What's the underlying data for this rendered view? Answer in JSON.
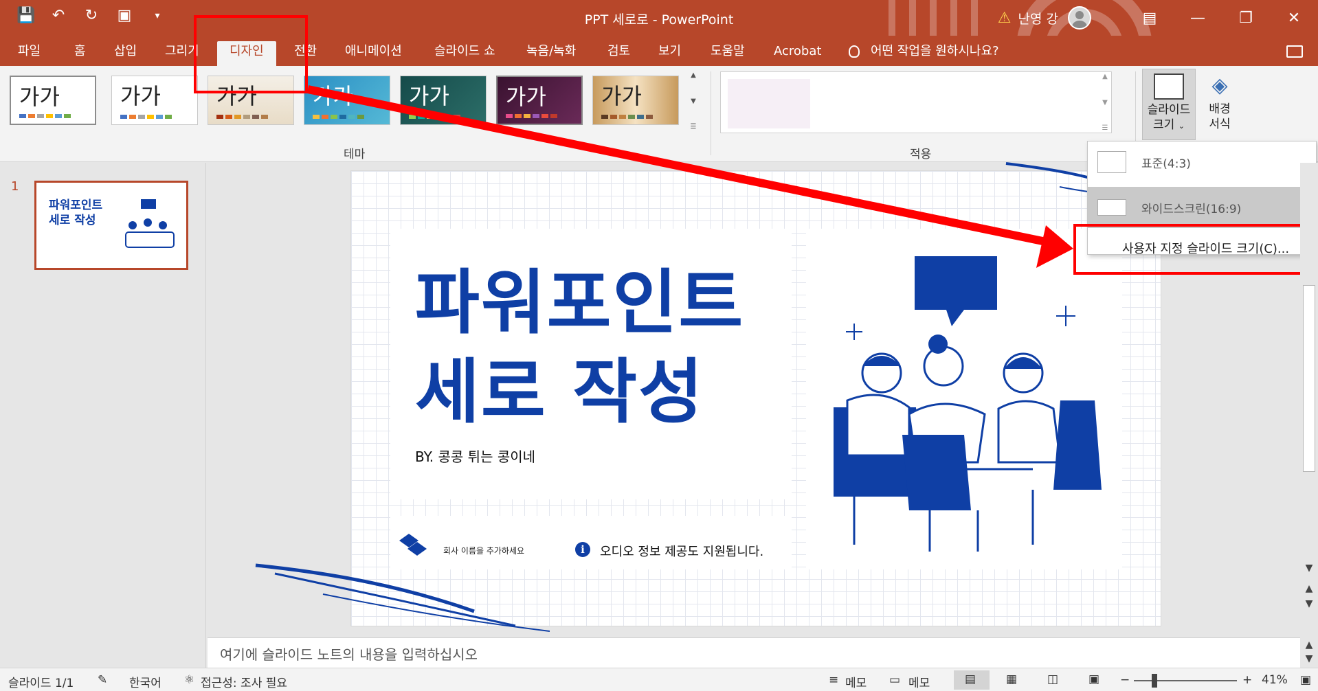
{
  "window": {
    "title": "PPT 세로로  -  PowerPoint",
    "user": "난영 강"
  },
  "tabs": [
    "파일",
    "홈",
    "삽입",
    "그리기",
    "디자인",
    "전환",
    "애니메이션",
    "슬라이드 쇼",
    "녹음/녹화",
    "검토",
    "보기",
    "도움말",
    "Acrobat"
  ],
  "tell_me": "어떤 작업을 원하시나요?",
  "ribbon": {
    "theme_sample": "가가",
    "themes_group": "테마",
    "variants_group": "적용",
    "slide_size_label": "슬라이드",
    "slide_size_label2": "크기",
    "bg_format_label": "배경",
    "bg_format_label2": "서식"
  },
  "slide_size_menu": {
    "standard": "표준(4:3)",
    "widescreen": "와이드스크린(16:9)",
    "custom": "사용자 지정 슬라이드 크기(C)..."
  },
  "thumbnails": [
    {
      "number": "1",
      "title": "파워포인트\n세로 작성"
    }
  ],
  "slide": {
    "title": "파워포인트\n세로 작성",
    "byline": "BY. 콩콩 튀는 콩이네",
    "company": "회사 이름을 추가하세요",
    "audio_notice": "오디오 정보 제공도 지원됩니다.",
    "brand_color": "#0f3fa5"
  },
  "notes_placeholder": "여기에 슬라이드 노트의 내용을 입력하십시오",
  "status": {
    "slide": "슬라이드 1/1",
    "language": "한국어",
    "accessibility": "접근성: 조사 필요",
    "notes": "메모",
    "comments": "메모",
    "zoom": "41%"
  },
  "colors": {
    "accent": "#b7472a",
    "annotation": "#ff0000"
  }
}
